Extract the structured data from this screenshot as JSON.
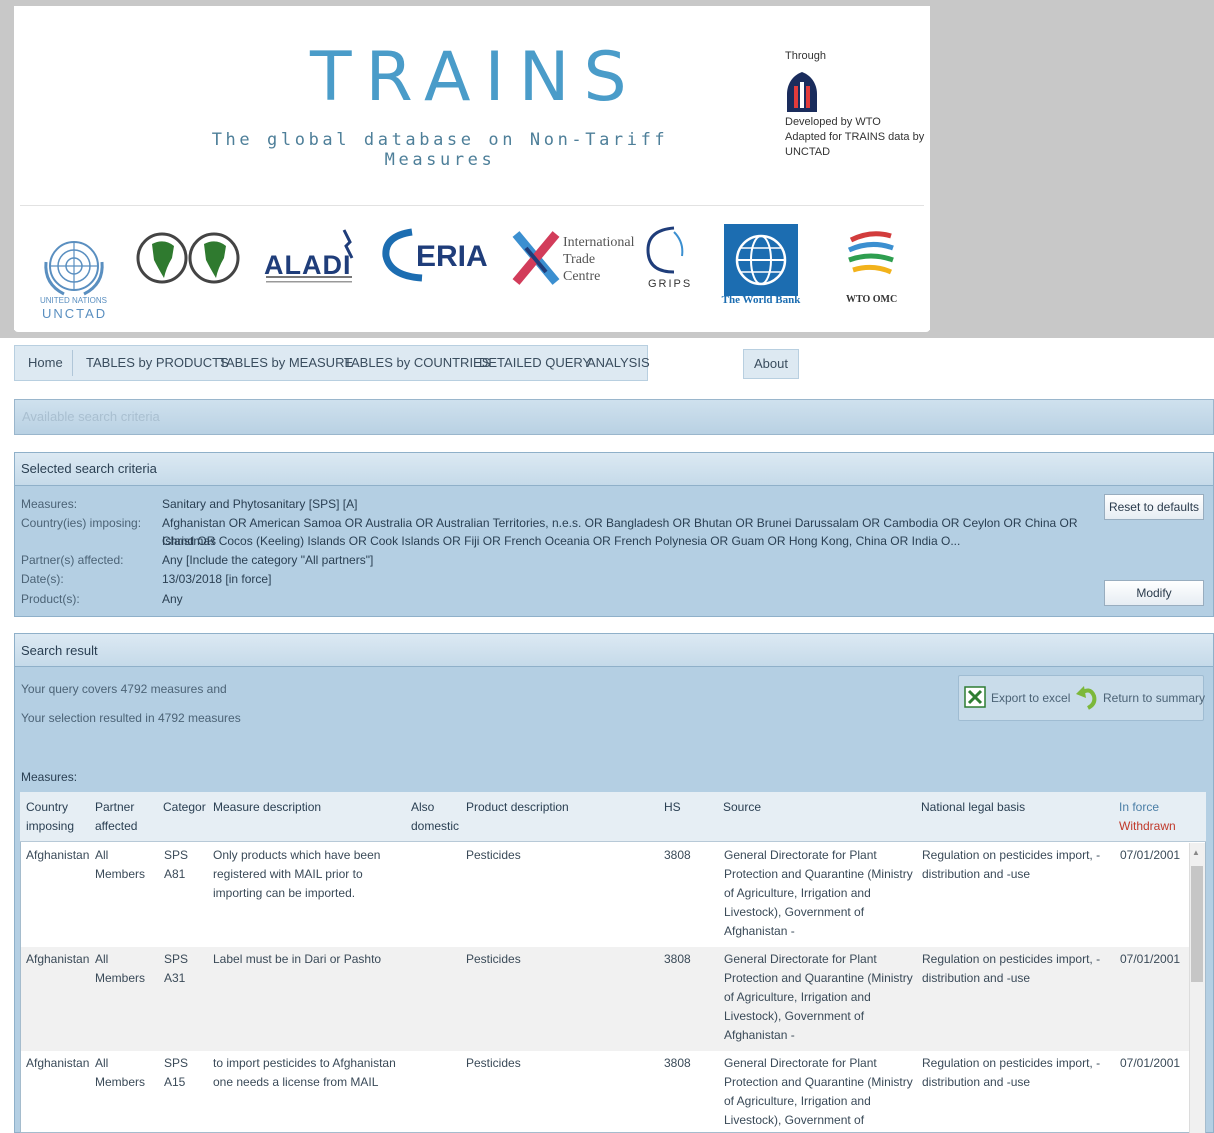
{
  "header": {
    "title": "TRAINS",
    "subtitle": "The global database on Non-Tariff Measures",
    "through": "Through",
    "dev_lines": [
      "Developed by WTO",
      "Adapted for TRAINS data by",
      "UNCTAD"
    ],
    "unctad_small": "UNITED NATIONS",
    "unctad": "UNCTAD",
    "aladi": "ALADI",
    "eria": "ERIA",
    "itc_lines": [
      "International",
      "Trade",
      "Centre"
    ],
    "grips": "GRIPS",
    "world_bank": "The World Bank",
    "wto": "WTO OMC"
  },
  "nav": {
    "items": [
      "Home",
      "TABLES by PRODUCTS",
      "TABLES by MEASURE",
      "TABLES by COUNTRIES",
      "DETAILED QUERY",
      "ANALYSIS"
    ],
    "about": "About"
  },
  "available": {
    "label": "Available search criteria"
  },
  "selected": {
    "title": "Selected search criteria",
    "labels": [
      "Measures:",
      "Country(ies) imposing:",
      "Partner(s) affected:",
      "Date(s):",
      "Product(s):"
    ],
    "measures": "Sanitary and Phytosanitary [SPS] [A]",
    "countries_line1": "Afghanistan OR American Samoa OR Australia OR Australian Territories, n.e.s. OR Bangladesh OR Bhutan OR Brunei Darussalam OR Cambodia OR Ceylon OR China OR Christmas",
    "countries_line2": "Island OR Cocos (Keeling) Islands OR Cook Islands OR Fiji OR French Oceania OR French Polynesia OR Guam OR Hong Kong, China OR India O...",
    "partners": "Any [Include the category \"All partners\"]",
    "dates": "13/03/2018 [in force]",
    "products": "Any",
    "reset": "Reset to defaults",
    "modify": "Modify"
  },
  "result": {
    "title": "Search result",
    "line1": "Your query covers 4792 measures and",
    "line2": "Your selection resulted in 4792 measures",
    "export": "Export to excel",
    "return": "Return to summary",
    "measures_label": "Measures:"
  },
  "table": {
    "headers": {
      "country": [
        "Country",
        "imposing"
      ],
      "partner": [
        "Partner",
        "affected"
      ],
      "category": "Categor",
      "description": "Measure description",
      "also": [
        "Also",
        "domestic"
      ],
      "product": "Product description",
      "hs": "HS",
      "source": "Source",
      "legal": "National legal basis",
      "inforce": "In force",
      "withdrawn": "Withdrawn"
    },
    "rows": [
      {
        "country": "Afghanistan",
        "partner": [
          "All",
          "Members"
        ],
        "category": [
          "SPS",
          "A81"
        ],
        "description": [
          "Only products which have been",
          "registered with MAIL prior to",
          "importing can be imported."
        ],
        "product": "Pesticides",
        "hs": "3808",
        "source": [
          "General Directorate for Plant",
          "Protection and Quarantine (Ministry",
          "of Agriculture, Irrigation and",
          "Livestock), Government of",
          "Afghanistan -"
        ],
        "legal": [
          "Regulation on pesticides import, -",
          "distribution and -use"
        ],
        "date": "07/01/2001"
      },
      {
        "country": "Afghanistan",
        "partner": [
          "All",
          "Members"
        ],
        "category": [
          "SPS",
          "A31"
        ],
        "description": [
          "Label must be in Dari or Pashto"
        ],
        "product": "Pesticides",
        "hs": "3808",
        "source": [
          "General Directorate for Plant",
          "Protection and Quarantine (Ministry",
          "of Agriculture, Irrigation and",
          "Livestock), Government of",
          "Afghanistan -"
        ],
        "legal": [
          "Regulation on pesticides import, -",
          "distribution and -use"
        ],
        "date": "07/01/2001"
      },
      {
        "country": "Afghanistan",
        "partner": [
          "All",
          "Members"
        ],
        "category": [
          "SPS",
          "A15"
        ],
        "description": [
          "to import pesticides to Afghanistan",
          "one needs a license from MAIL"
        ],
        "product": "Pesticides",
        "hs": "3808",
        "source": [
          "General Directorate for Plant",
          "Protection and Quarantine (Ministry",
          "of Agriculture, Irrigation and",
          "Livestock), Government of"
        ],
        "legal": [
          "Regulation on pesticides import, -",
          "distribution and -use"
        ],
        "date": "07/01/2001"
      }
    ]
  },
  "colors": {
    "accent": "#4a9cc9",
    "panel": "#b4cfe3",
    "withdrawn": "#c0392b"
  }
}
